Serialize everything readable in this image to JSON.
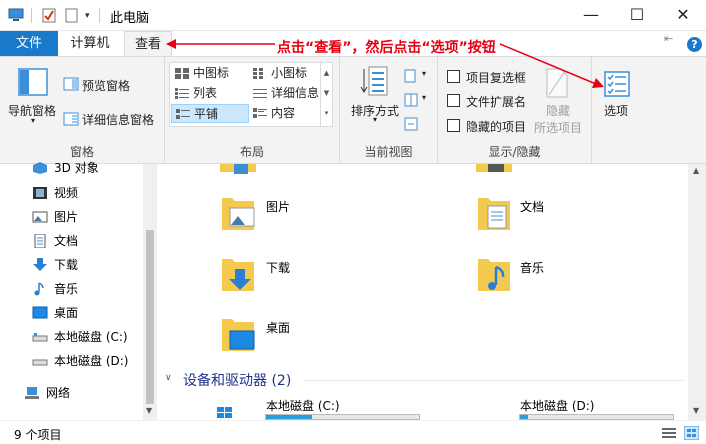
{
  "window": {
    "title": "此电脑",
    "quick_access_dropdown": "▾",
    "minimize": "—",
    "maximize": "☐",
    "close": "✕"
  },
  "tabs": {
    "file": "文件",
    "computer": "计算机",
    "view": "查看"
  },
  "annotation": {
    "text": "点击“查看”，然后点击“选项”按钮",
    "color": "#e60012"
  },
  "ribbon": {
    "panes": {
      "nav_pane": "导航窗格",
      "preview_pane": "预览窗格",
      "details_pane": "详细信息窗格",
      "label": "窗格"
    },
    "layout": {
      "items": [
        "中图标",
        "小图标",
        "列表",
        "详细信息",
        "平铺",
        "内容"
      ],
      "selected": "平铺",
      "label": "布局"
    },
    "current_view": {
      "sort_by": "排序方式",
      "label": "当前视图"
    },
    "show_hide": {
      "item_checkboxes": "项目复选框",
      "file_extensions": "文件扩展名",
      "hidden_items": "隐藏的项目",
      "hide": "隐藏",
      "hide_selected": "所选项目",
      "label": "显示/隐藏"
    },
    "options": "选项"
  },
  "nav": {
    "items": [
      {
        "label": "3D 对象",
        "icon": "3d-objects-icon"
      },
      {
        "label": "视频",
        "icon": "videos-icon"
      },
      {
        "label": "图片",
        "icon": "pictures-icon"
      },
      {
        "label": "文档",
        "icon": "documents-icon"
      },
      {
        "label": "下载",
        "icon": "downloads-icon"
      },
      {
        "label": "音乐",
        "icon": "music-icon"
      },
      {
        "label": "桌面",
        "icon": "desktop-icon"
      },
      {
        "label": "本地磁盘 (C:)",
        "icon": "drive-c-icon"
      },
      {
        "label": "本地磁盘 (D:)",
        "icon": "drive-d-icon"
      },
      {
        "label": "网络",
        "icon": "network-icon"
      }
    ]
  },
  "content": {
    "folders": [
      {
        "label": "图片",
        "icon": "pictures-folder-icon"
      },
      {
        "label": "文档",
        "icon": "documents-folder-icon"
      },
      {
        "label": "下载",
        "icon": "downloads-folder-icon"
      },
      {
        "label": "音乐",
        "icon": "music-folder-icon"
      },
      {
        "label": "桌面",
        "icon": "desktop-folder-icon"
      }
    ],
    "devices_header": "设备和驱动器 (2)",
    "drives": [
      {
        "label": "本地磁盘 (C:)",
        "used_fraction": 0.3
      },
      {
        "label": "本地磁盘 (D:)",
        "used_fraction": 0.05
      }
    ]
  },
  "status": {
    "item_count": "9 个项目"
  },
  "colors": {
    "accent": "#1979ca",
    "ribbon_bg": "#f3f3f3",
    "selected": "#cce8ff",
    "drive_fill": "#26a0da"
  }
}
